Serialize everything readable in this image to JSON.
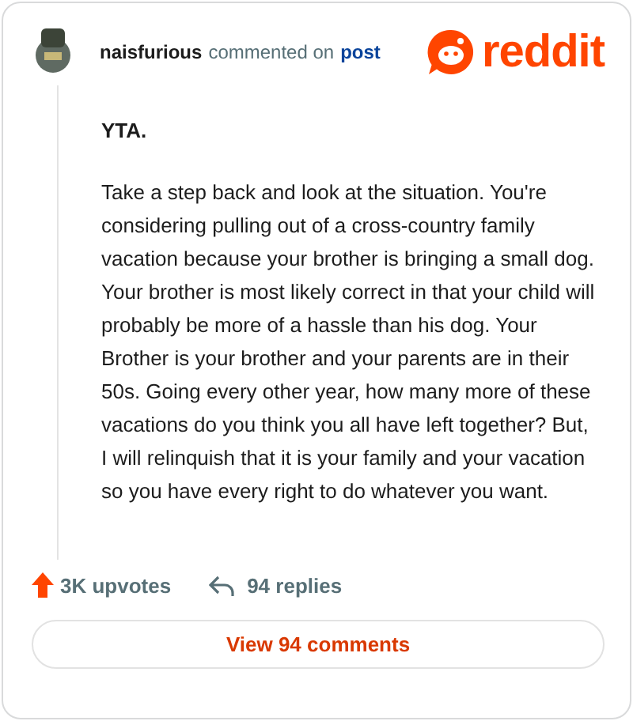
{
  "header": {
    "username": "naisfurious",
    "action": "commented on",
    "link": "post",
    "logo": "reddit"
  },
  "comment": {
    "title": "YTA.",
    "body": "Take a step back and look at the situation. You're considering pulling out of a cross-country family vacation because your brother is bringing a small dog. Your brother is most likely correct in that your child will probably be more of a hassle than his dog. Your Brother is your brother and your parents are in their 50s. Going every other year, how many more of these vacations do you think you all have left together? But, I will relinquish that it is your family and your vacation so you have every right to do whatever you want."
  },
  "stats": {
    "upvotes": "3K upvotes",
    "replies": "94 replies"
  },
  "button": "View 94 comments"
}
